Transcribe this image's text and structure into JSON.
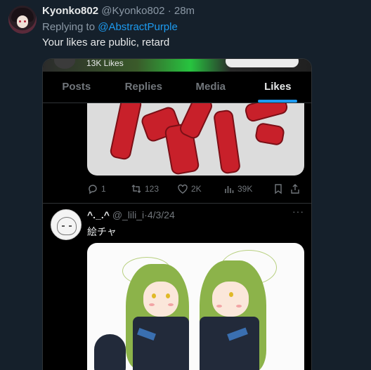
{
  "reply": {
    "display_name": "Kyonko802",
    "handle": "@Kyonko802",
    "separator": "·",
    "time": "28m",
    "replying_prefix": "Replying to ",
    "replying_to": "@AbstractPurple",
    "text": "Your likes are public, retard"
  },
  "screenshot": {
    "likes_count": "13K Likes",
    "tabs": [
      {
        "label": "Posts",
        "active": false
      },
      {
        "label": "Replies",
        "active": false
      },
      {
        "label": "Media",
        "active": false
      },
      {
        "label": "Likes",
        "active": true
      }
    ],
    "tweet1_actions": {
      "replies": "1",
      "reposts": "123",
      "likes": "2K",
      "views": "39K"
    },
    "tweet2": {
      "display_name": "^._.^",
      "handle": "@_lili_i",
      "separator": "·",
      "date": "4/3/24",
      "more": "···",
      "text": "絵チャ"
    }
  },
  "colors": {
    "background": "#15202b",
    "accent": "#1d9bf0",
    "muted": "#8b98a5"
  }
}
